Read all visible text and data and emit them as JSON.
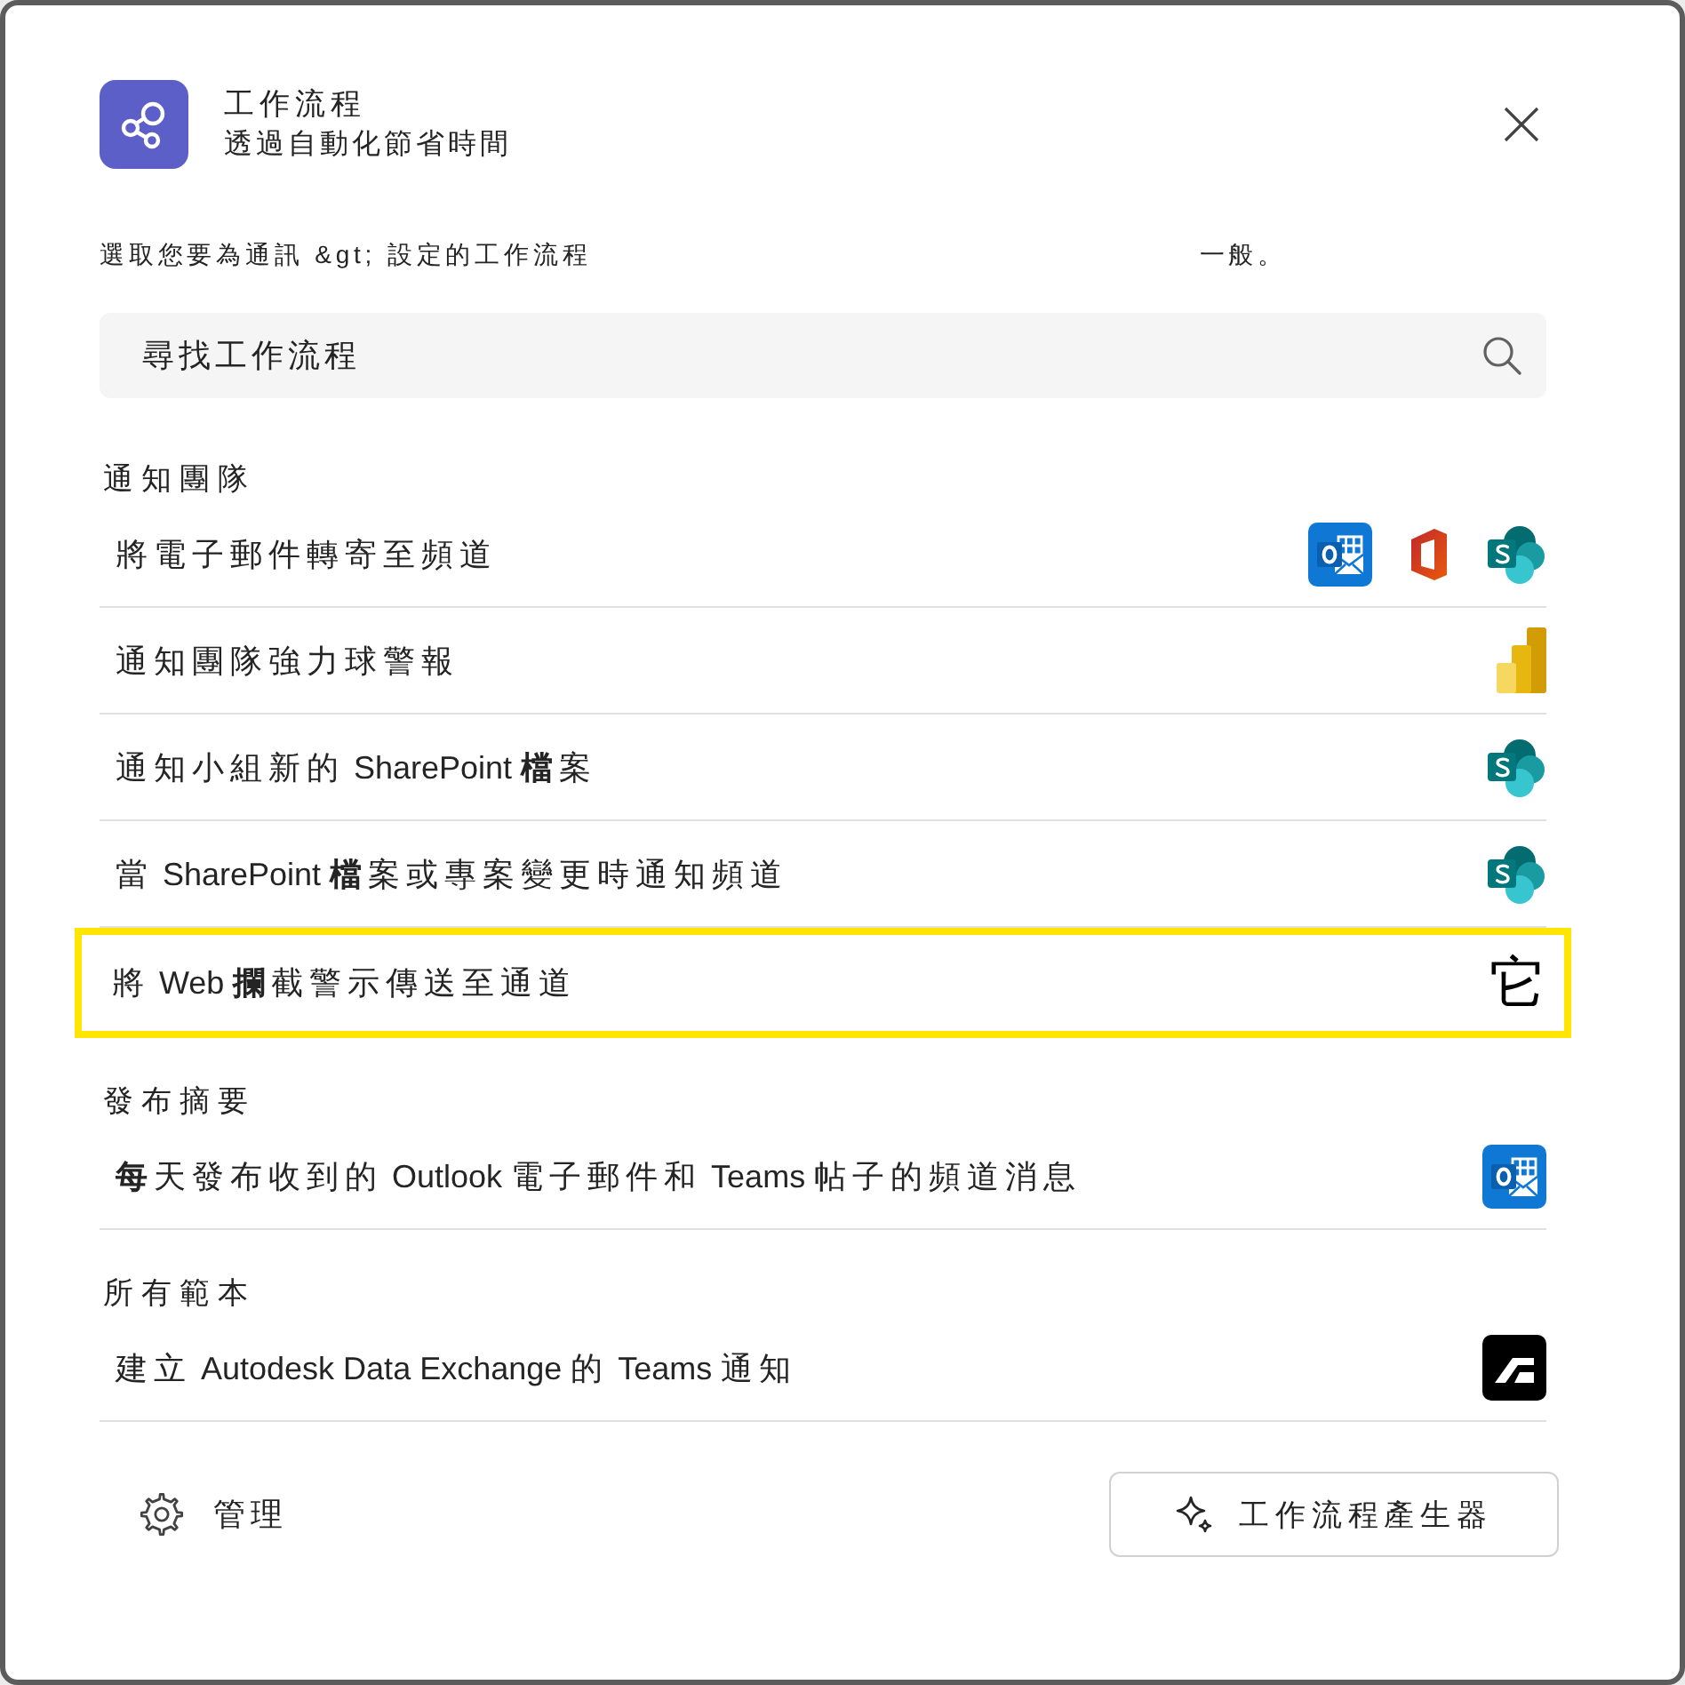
{
  "header": {
    "title": "工作流程",
    "subtitle": "透過自動化節省時間"
  },
  "instruction": [
    "選取您要為通訊 &gt; 設定的工作流程",
    "一般。"
  ],
  "search": {
    "placeholder": "尋找工作流程"
  },
  "sections": [
    {
      "heading": "通知團隊",
      "items": [
        {
          "label": "將電子郵件轉寄至頻道",
          "highlighted": false,
          "icons": [
            {
              "kind": "outlook"
            },
            {
              "kind": "office"
            },
            {
              "kind": "sharepoint"
            }
          ]
        },
        {
          "label": "通知團隊強力球警報",
          "highlighted": false,
          "icons": [
            {
              "kind": "powerbi"
            }
          ]
        },
        {
          "label": "通知小組新的 SharePoint **檔**案",
          "highlighted": false,
          "icons": [
            {
              "kind": "sharepoint"
            }
          ]
        },
        {
          "label": "當 SharePoint **檔**案或專案變更時通知頻道",
          "highlighted": false,
          "icons": [
            {
              "kind": "sharepoint"
            }
          ]
        },
        {
          "label": "將 Web **攔**截警示傳送至通道",
          "highlighted": true,
          "icons": [
            {
              "kind": "glyph",
              "text": "它"
            }
          ]
        }
      ]
    },
    {
      "heading": "發布摘要",
      "items": [
        {
          "label": "**每**天發布收到的 Outlook 電子郵件和 Teams 帖子的頻道消息",
          "highlighted": false,
          "icons": [
            {
              "kind": "outlook"
            }
          ]
        }
      ]
    },
    {
      "heading": "所有範本",
      "items": [
        {
          "label": "建立 Autodesk Data Exchange 的 Teams 通知",
          "highlighted": false,
          "icons": [
            {
              "kind": "autodesk"
            }
          ]
        }
      ]
    }
  ],
  "footer": {
    "manage": "管理",
    "builder_button": "工作流程產生器"
  }
}
